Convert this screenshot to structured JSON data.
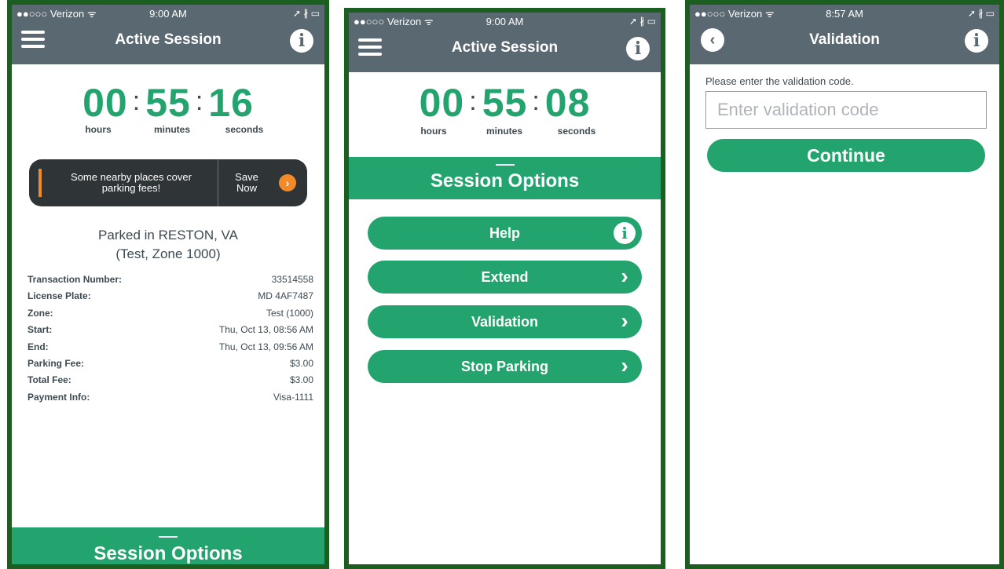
{
  "screens": [
    {
      "status": {
        "carrier": "●●○○○ Verizon ᯤ",
        "time": "9:00 AM",
        "icons": "➚ ∦ ▭"
      },
      "nav": {
        "title": "Active Session"
      },
      "timer": {
        "hours": "00",
        "minutes": "55",
        "seconds": "16",
        "sep": ":",
        "hours_label": "hours",
        "minutes_label": "minutes",
        "seconds_label": "seconds"
      },
      "promo": {
        "text": "Some nearby places cover parking fees!",
        "save": "Save Now",
        "go_icon": "›"
      },
      "parked": {
        "line1": "Parked in RESTON, VA",
        "line2": "(Test, Zone 1000)"
      },
      "details": [
        {
          "label": "Transaction Number:",
          "value": "33514558"
        },
        {
          "label": "License Plate:",
          "value": "MD 4AF7487"
        },
        {
          "label": "Zone:",
          "value": "Test (1000)"
        },
        {
          "label": "Start:",
          "value": "Thu, Oct 13, 08:56 AM"
        },
        {
          "label": "End:",
          "value": "Thu, Oct 13, 09:56 AM"
        },
        {
          "label": "Parking Fee:",
          "value": "$3.00"
        },
        {
          "label": "Total Fee:",
          "value": "$3.00"
        },
        {
          "label": "Payment Info:",
          "value": "Visa-1111"
        }
      ],
      "options_title": "Session Options"
    },
    {
      "status": {
        "carrier": "●●○○○ Verizon ᯤ",
        "time": "9:00 AM",
        "icons": "➚ ∦ ▭"
      },
      "nav": {
        "title": "Active Session"
      },
      "timer": {
        "hours": "00",
        "minutes": "55",
        "seconds": "08",
        "sep": ":",
        "hours_label": "hours",
        "minutes_label": "minutes",
        "seconds_label": "seconds"
      },
      "options_title": "Session Options",
      "buttons": [
        {
          "label": "Help",
          "icon": "info-icon"
        },
        {
          "label": "Extend",
          "icon": "chevron-right-icon"
        },
        {
          "label": "Validation",
          "icon": "chevron-right-icon"
        },
        {
          "label": "Stop Parking",
          "icon": "chevron-right-icon"
        }
      ]
    },
    {
      "status": {
        "carrier": "●●○○○ Verizon ᯤ",
        "time": "8:57 AM",
        "icons": "➚ ∦ ▭"
      },
      "nav": {
        "title": "Validation"
      },
      "prompt": "Please enter the validation code.",
      "input": {
        "placeholder": "Enter validation code",
        "value": ""
      },
      "continue_label": "Continue"
    }
  ],
  "glyphs": {
    "info": "i",
    "chevron": "›",
    "back": "‹"
  },
  "colors": {
    "accent": "#23a36d",
    "nav": "#5a6872",
    "frame": "#1b5e20",
    "promo_accent": "#f28b27"
  }
}
